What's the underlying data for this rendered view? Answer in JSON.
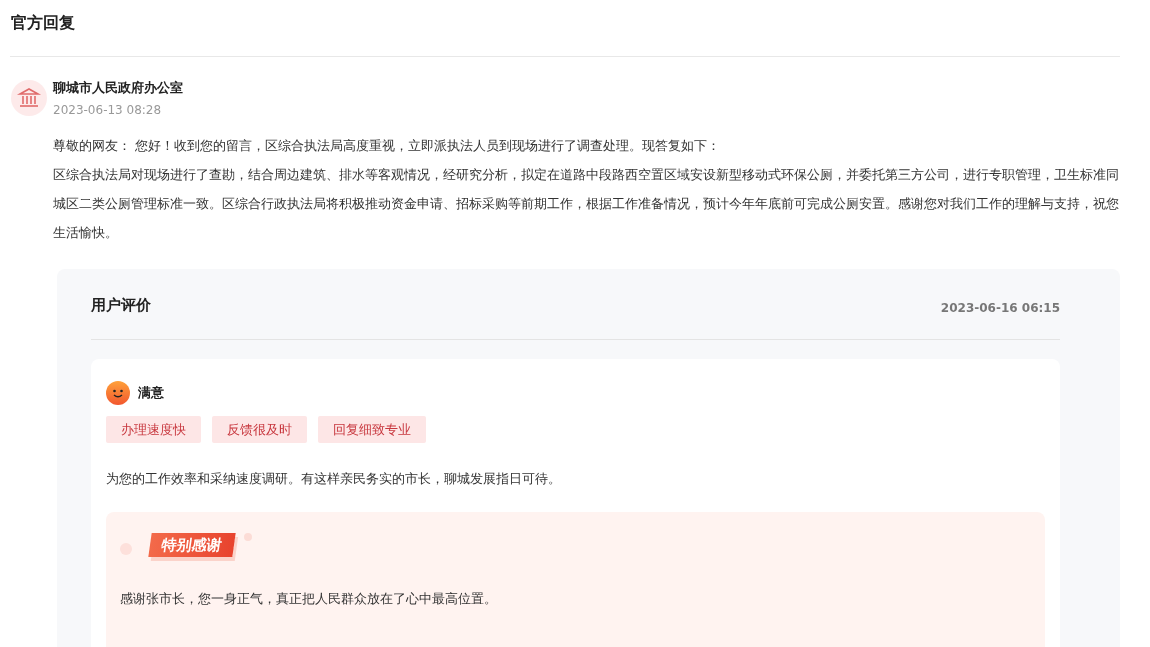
{
  "section_title": "官方回复",
  "reply": {
    "author": "聊城市人民政府办公室",
    "time": "2023-06-13 08:28",
    "paragraphs": [
      "尊敬的网友： 您好！收到您的留言，区综合执法局高度重视，立即派执法人员到现场进行了调查处理。现答复如下：",
      "区综合执法局对现场进行了查勘，结合周边建筑、排水等客观情况，经研究分析，拟定在道路中段路西空置区域安设新型移动式环保公厕，并委托第三方公司，进行专职管理，卫生标准同城区二类公厕管理标准一致。区综合行政执法局将积极推动资金申请、招标采购等前期工作，根据工作准备情况，预计今年年底前可完成公厕安置。感谢您对我们工作的理解与支持，祝您生活愉快。"
    ]
  },
  "evaluation": {
    "title": "用户评价",
    "time": "2023-06-16 06:15",
    "rating": "满意",
    "tags": [
      "办理速度快",
      "反馈很及时",
      "回复细致专业"
    ],
    "comment": "为您的工作效率和采纳速度调研。有这样亲民务实的市长，聊城发展指日可待。",
    "thanks": {
      "badge": "特别感谢",
      "text": "感谢张市长，您一身正气，真正把人民群众放在了心中最高位置。"
    }
  }
}
